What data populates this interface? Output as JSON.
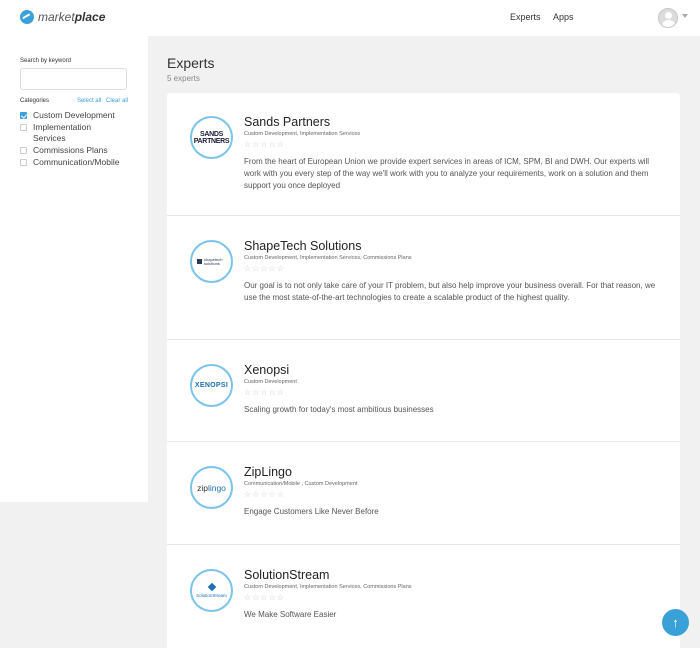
{
  "header": {
    "logo_text": "market",
    "logo_text_bold": "place",
    "nav": {
      "experts": "Experts",
      "apps": "Apps"
    }
  },
  "sidebar": {
    "search_label": "Search by keyword",
    "search_placeholder": "",
    "categories_label": "Categories",
    "select_all": "Select all",
    "clear_all": "Clear all",
    "categories": [
      {
        "label": "Custom Development",
        "checked": true
      },
      {
        "label": "Implementation Services",
        "checked": false
      },
      {
        "label": "Commissions Plans",
        "checked": false
      },
      {
        "label": "Communication/Mobile",
        "checked": false
      }
    ]
  },
  "main": {
    "title": "Experts",
    "count": "5 experts",
    "experts": [
      {
        "name": "Sands Partners",
        "logo": "SANDS PARTNERS",
        "categories": "Custom Development, Implementation Services",
        "rating": 0,
        "description": "From the heart of European Union we provide expert services in areas of ICM, SPM, BI and DWH. Our experts will work with you every step of the way we'll work with you to analyze your requirements, work on a solution and them support you once deployed"
      },
      {
        "name": "ShapeTech Solutions",
        "logo": "shapetech solutions",
        "categories": "Custom Development, Implementation Services, Commissions Plans",
        "rating": 0,
        "description": "Our goal is to not only take care of your IT problem, but also help improve your business overall. For that reason, we use the most state-of-the-art technologies to create a scalable product of the highest quality."
      },
      {
        "name": "Xenopsi",
        "logo": "XENOPSI",
        "categories": "Custom Development",
        "rating": 0,
        "description": "Scaling growth for today's most ambitious businesses"
      },
      {
        "name": "ZipLingo",
        "logo": "zip",
        "logo_accent": "lingo",
        "categories": "Communication/Mobile , Custom Development",
        "rating": 0,
        "description": "Engage Customers Like Never Before"
      },
      {
        "name": "SolutionStream",
        "logo": "SolutionStream",
        "categories": "Custom Development, Implementation Services, Commissions Plans",
        "rating": 0,
        "description": "We Make Software Easier"
      }
    ]
  },
  "stars": "☆☆☆☆☆",
  "colors": {
    "accent": "#3aa0d8",
    "logo_ring": "#7ac4ea"
  },
  "fab_icon": "↑"
}
